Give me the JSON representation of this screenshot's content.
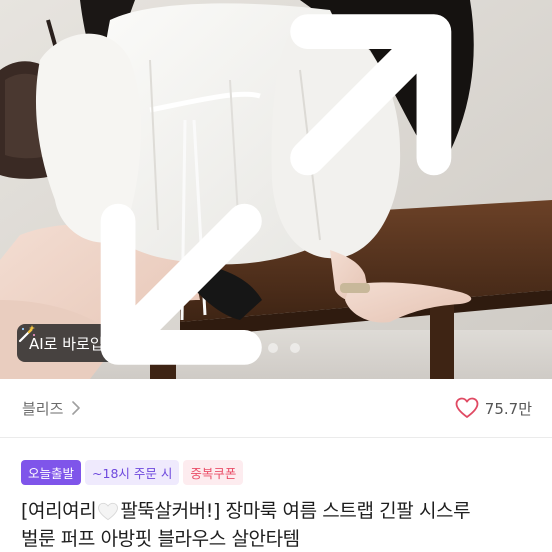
{
  "photo": {
    "description_alt": "white puff-sleeve blouse product photo",
    "ai_button_label": "AI로 바로입기",
    "carousel": {
      "count": 3,
      "active_index": 0
    }
  },
  "meta": {
    "category_label": "블리즈",
    "like_count": "75.7만"
  },
  "badges": {
    "today": "오늘출발",
    "time": "~18시 주문 시",
    "coupon": "중복쿠폰"
  },
  "product": {
    "title_part1": "[여리여리",
    "title_part2": "팔뚝살커버!] 장마룩 여름 스트랩 긴팔 시스루",
    "title_line2": "벌룬 퍼프 아방핏 블라우스 살안타템"
  },
  "icons": {
    "ai": "magic-wand-icon",
    "expand": "expand-icon",
    "chevron": "chevron-right-icon",
    "like": "heart-outline-icon",
    "title_heart": "white-heart-emoji"
  },
  "colors": {
    "accent": "#7f55ea",
    "coupon": "#ea4f69",
    "heart": "#e04a63"
  }
}
